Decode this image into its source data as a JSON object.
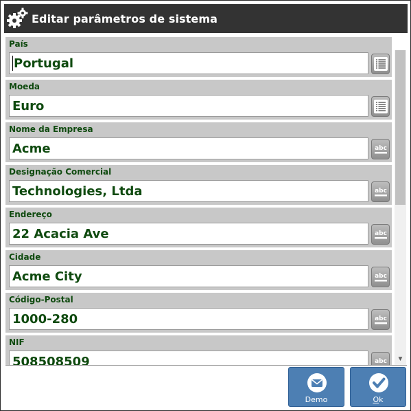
{
  "window": {
    "title": "Editar parâmetros de sistema"
  },
  "fields": [
    {
      "label": "País",
      "value": "Portugal",
      "button_icon": "list-icon"
    },
    {
      "label": "Moeda",
      "value": "Euro",
      "button_icon": "list-icon"
    },
    {
      "label": "Nome da Empresa",
      "value": "Acme",
      "button_icon": "keyboard-abc-icon"
    },
    {
      "label": "Designação Comercial",
      "value": "Technologies, Ltda",
      "button_icon": "keyboard-abc-icon"
    },
    {
      "label": "Endereço",
      "value": "22 Acacia Ave",
      "button_icon": "keyboard-abc-icon"
    },
    {
      "label": "Cidade",
      "value": "Acme City",
      "button_icon": "keyboard-abc-icon"
    },
    {
      "label": "Código-Postal",
      "value": "1000-280",
      "button_icon": "keyboard-abc-icon"
    },
    {
      "label": "NIF",
      "value": "508508509",
      "button_icon": "keyboard-abc-icon"
    }
  ],
  "buttons": {
    "demo": {
      "label": "Demo",
      "icon": "envelope-icon"
    },
    "ok": {
      "label": "Ok",
      "icon": "checkmark-icon"
    }
  },
  "colors": {
    "titlebar": "#333333",
    "field_text": "#0f4a0f",
    "field_bg": "#c8c8c8",
    "action_button": "#4d7fb3"
  }
}
